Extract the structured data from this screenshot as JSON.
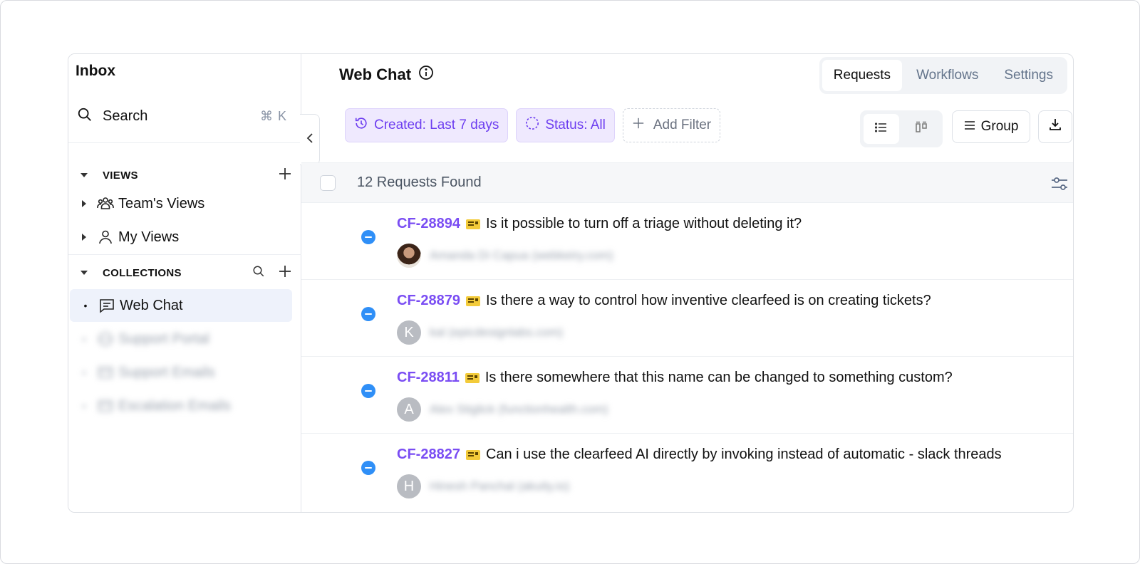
{
  "sidebar": {
    "title": "Inbox",
    "search_label": "Search",
    "search_shortcut": "⌘ K",
    "views_header": "VIEWS",
    "views": [
      {
        "label": "Team's Views",
        "icon": "team-icon"
      },
      {
        "label": "My Views",
        "icon": "user-icon"
      }
    ],
    "collections_header": "COLLECTIONS",
    "collections": [
      {
        "label": "Web Chat",
        "icon": "chat-icon",
        "active": true
      },
      {
        "label": "Support Portal",
        "icon": "globe-icon",
        "blurred": true
      },
      {
        "label": "Support Emails",
        "icon": "mail-icon",
        "blurred": true
      },
      {
        "label": "Escalation Emails",
        "icon": "mail-icon",
        "blurred": true
      }
    ]
  },
  "header": {
    "title": "Web Chat",
    "tabs": [
      {
        "label": "Requests",
        "active": true
      },
      {
        "label": "Workflows"
      },
      {
        "label": "Settings"
      }
    ]
  },
  "filters": {
    "created": "Created: Last 7 days",
    "status": "Status: All",
    "add": "Add Filter"
  },
  "toolbar": {
    "group_label": "Group"
  },
  "list": {
    "count_label": "12 Requests Found",
    "rows": [
      {
        "id": "CF-28894",
        "question": "Is it possible to turn off a triage without deleting it?",
        "avatar_letter": "",
        "avatar_photo": true,
        "requester": "Amanda Di Capua  (webkeiry.com)"
      },
      {
        "id": "CF-28879",
        "question": "Is there a way to control how inventive clearfeed is on creating tickets?",
        "avatar_letter": "K",
        "requester": "kal  (epicdesignlabs.com)"
      },
      {
        "id": "CF-28811",
        "question": "Is there somewhere that this name can be changed to something custom?",
        "avatar_letter": "A",
        "requester": "Alex Stiglick  (functionhealth.com)"
      },
      {
        "id": "CF-28827",
        "question": "Can i use the clearfeed AI directly by invoking instead of automatic - slack threads",
        "avatar_letter": "H",
        "requester": "Hinesh Panchal  (akuity.io)"
      }
    ]
  },
  "colors": {
    "accent": "#7a4df3",
    "status_blue": "#2f8ff7",
    "chip_bg": "#efe9fe"
  }
}
